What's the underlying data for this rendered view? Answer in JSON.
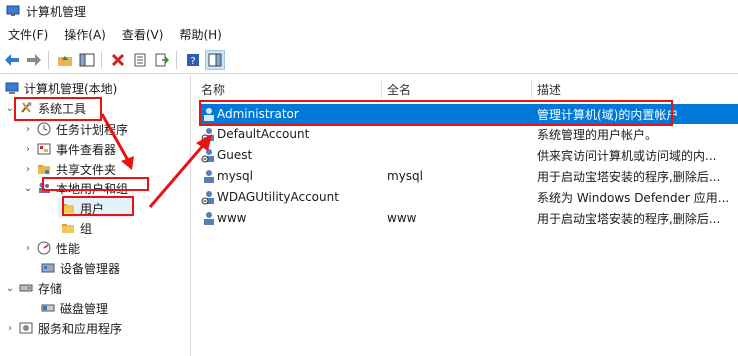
{
  "window": {
    "title": "计算机管理"
  },
  "menu": [
    {
      "label": "文件(F)"
    },
    {
      "label": "操作(A)"
    },
    {
      "label": "查看(V)"
    },
    {
      "label": "帮助(H)"
    }
  ],
  "toolbar": {
    "icons": [
      "back-arrow-icon",
      "forward-arrow-icon",
      "up-folder-icon",
      "show-hide-tree-icon",
      "delete-icon",
      "properties-icon",
      "export-icon",
      "help-icon",
      "show-pane-icon"
    ]
  },
  "tree": {
    "root": "计算机管理(本地)",
    "system_tools": "系统工具",
    "task_scheduler": "任务计划程序",
    "event_viewer": "事件查看器",
    "shared_folders": "共享文件夹",
    "local_users_groups": "本地用户和组",
    "users": "用户",
    "groups": "组",
    "performance": "性能",
    "device_manager": "设备管理器",
    "storage": "存储",
    "disk_management": "磁盘管理",
    "services_apps": "服务和应用程序"
  },
  "list": {
    "headers": {
      "name": "名称",
      "fullname": "全名",
      "description": "描述"
    },
    "rows": [
      {
        "name": "Administrator",
        "fullname": "",
        "description": "管理计算机(域)的内置帐户"
      },
      {
        "name": "DefaultAccount",
        "fullname": "",
        "description": "系统管理的用户帐户。"
      },
      {
        "name": "Guest",
        "fullname": "",
        "description": "供来宾访问计算机或访问域的内..."
      },
      {
        "name": "mysql",
        "fullname": "mysql",
        "description": "用于启动宝塔安装的程序,删除后..."
      },
      {
        "name": "WDAGUtilityAccount",
        "fullname": "",
        "description": "系统为 Windows Defender 应用..."
      },
      {
        "name": "www",
        "fullname": "www",
        "description": "用于启动宝塔安装的程序,删除后..."
      }
    ]
  },
  "colors": {
    "selection": "#0078d7",
    "annotation": "#e81313",
    "tree_selection": "#e5f1fb"
  }
}
